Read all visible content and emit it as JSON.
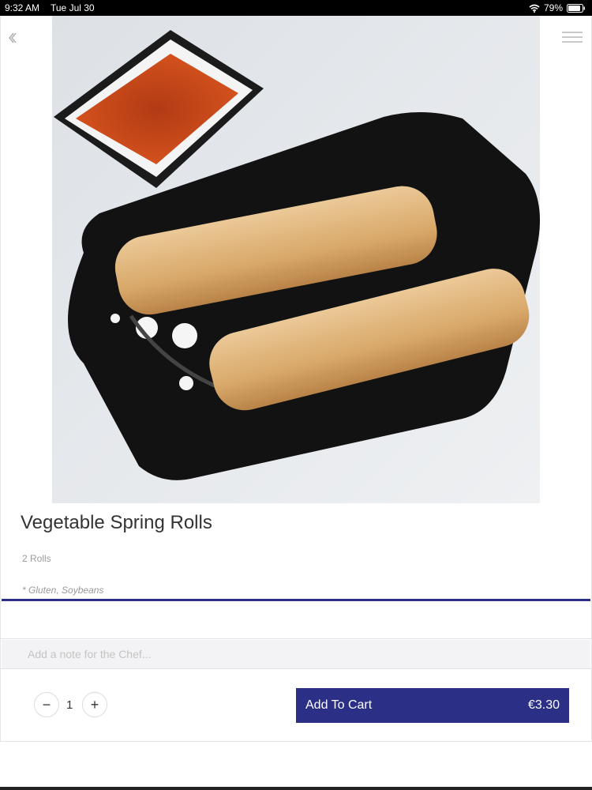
{
  "status_bar": {
    "time": "9:32 AM",
    "date": "Tue Jul 30",
    "battery": "79%"
  },
  "product": {
    "title": "Vegetable Spring Rolls",
    "description": "2 Rolls",
    "allergens": "* Gluten, Soybeans",
    "image_alt": "spring rolls on black plate with sweet chili sauce"
  },
  "note": {
    "placeholder": "Add a note for the Chef...",
    "value": ""
  },
  "quantity": {
    "minus": "−",
    "value": "1",
    "plus": "+"
  },
  "cart": {
    "label": "Add To Cart",
    "price": "€3.30"
  },
  "colors": {
    "accent": "#2b3086"
  }
}
